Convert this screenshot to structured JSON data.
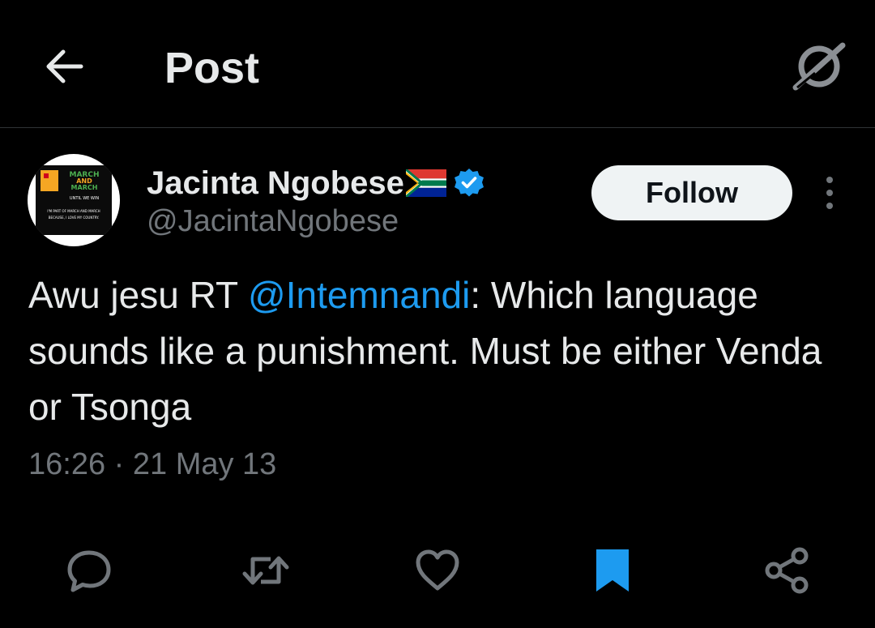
{
  "header": {
    "title": "Post",
    "back_icon": "arrow-left-icon",
    "grok_icon": "grok-icon"
  },
  "author": {
    "name": "Jacinta Ngobese",
    "handle": "@JacintaNgobese",
    "verified": true,
    "flag": "south-africa-flag",
    "avatar_text": [
      "MARCH",
      "AND",
      "MARCH",
      "UNTIL WE WIN",
      "I'M PART OF MARCH AND MARCH",
      "BECAUSE, I LOVE MY COUNTRY."
    ]
  },
  "follow_button": "Follow",
  "tweet": {
    "prefix": "Awu jesu RT ",
    "mention": "@Intemnandi",
    "body": ": Which language sounds like a punishment. Must be either Venda or Tsonga",
    "timestamp": "16:26 · 21 May 13"
  },
  "actions": [
    "reply-icon",
    "retweet-icon",
    "like-icon",
    "bookmark-icon",
    "share-icon"
  ],
  "colors": {
    "background": "#000000",
    "text": "#e7e9ea",
    "secondary": "#71767b",
    "accent": "#1d9bf0",
    "divider": "#2f3336"
  }
}
